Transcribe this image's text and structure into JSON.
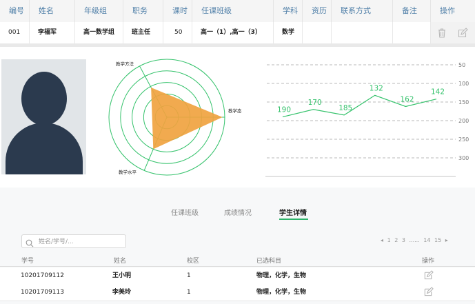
{
  "teacher_table": {
    "headers": [
      "编号",
      "姓名",
      "年级组",
      "职务",
      "课时",
      "任课班级",
      "学科",
      "资历",
      "联系方式",
      "备注",
      "操作"
    ],
    "row": {
      "id": "001",
      "name": "李福军",
      "grade_group": "高一数学组",
      "position": "班主任",
      "hours": "50",
      "classes": "高一（1）,高一（3）",
      "subject": "数学",
      "seniority": "",
      "contact": "",
      "remark": ""
    },
    "row_actions": [
      "trash-icon",
      "edit-icon"
    ]
  },
  "radar": {
    "labels": [
      "教学方法",
      "教学态度",
      "教学水平"
    ],
    "values": [
      0.58,
      0.96,
      0.6
    ],
    "rings": 5,
    "fill_color": "#f0a340",
    "ring_color": "#34c26b"
  },
  "chart_data": {
    "type": "line",
    "x": [
      1,
      2,
      3,
      4,
      5,
      6
    ],
    "values": [
      190,
      170,
      185,
      132,
      162,
      142
    ],
    "data_labels": [
      "190",
      "170",
      "185",
      "132",
      "162",
      "142"
    ],
    "y_ticks": [
      "50",
      "100",
      "150",
      "200",
      "250",
      "300"
    ],
    "ylim": [
      50,
      300
    ],
    "y_inverted": true,
    "grid": "dashed horizontal",
    "line_color": "#34c26b",
    "xlabel": "",
    "ylabel": "",
    "title": ""
  },
  "tabs": [
    {
      "label": "任课班级",
      "active": false
    },
    {
      "label": "成绩情况",
      "active": false
    },
    {
      "label": "学生详情",
      "active": true
    }
  ],
  "search": {
    "placeholder": "姓名/学号/..."
  },
  "pager": {
    "prev": "◂",
    "pages_a": [
      "1",
      "2",
      "3"
    ],
    "ellipsis": "......",
    "pages_b": [
      "14",
      "15"
    ],
    "next": "▸"
  },
  "student_table": {
    "headers": [
      "学号",
      "姓名",
      "校区",
      "已选科目",
      "操作"
    ],
    "rows": [
      {
        "sid": "10201709112",
        "name": "王小明",
        "campus": "1",
        "subjects": "物理，化学，生物"
      },
      {
        "sid": "10201709113",
        "name": "李美玲",
        "campus": "1",
        "subjects": "物理，化学，生物"
      }
    ]
  },
  "colors": {
    "accent": "#2db36a",
    "header_text": "#4f7fa8",
    "avatar": "#2b3a4e"
  }
}
